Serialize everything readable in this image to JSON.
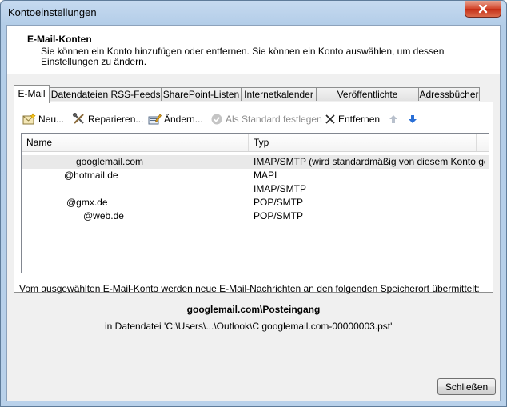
{
  "window": {
    "title": "Kontoeinstellungen"
  },
  "header": {
    "title": "E-Mail-Konten",
    "description": "Sie können ein Konto hinzufügen oder entfernen. Sie können ein Konto auswählen, um dessen Einstellungen zu ändern."
  },
  "tabs": [
    {
      "label": "E-Mail",
      "active": true
    },
    {
      "label": "Datendateien"
    },
    {
      "label": "RSS-Feeds"
    },
    {
      "label": "SharePoint-Listen"
    },
    {
      "label": "Internetkalender"
    },
    {
      "label": "Veröffentlichte Kalender"
    },
    {
      "label": "Adressbücher"
    }
  ],
  "toolbar": {
    "new_label": "Neu...",
    "repair_label": "Reparieren...",
    "change_label": "Ändern...",
    "default_label": "Als Standard festlegen",
    "remove_label": "Entfernen"
  },
  "accounts": {
    "columns": {
      "name": "Name",
      "type": "Typ"
    },
    "rows": [
      {
        "name": "googlemail.com",
        "type": "IMAP/SMTP (wird standardmäßig von diesem Konto ge...",
        "selected": true
      },
      {
        "name": "@hotmail.de",
        "type": "MAPI"
      },
      {
        "name": "",
        "type": "IMAP/SMTP"
      },
      {
        "name": "@gmx.de",
        "type": "POP/SMTP"
      },
      {
        "name": "@web.de",
        "type": "POP/SMTP"
      }
    ]
  },
  "delivery": {
    "info": "Vom ausgewählten E-Mail-Konto werden neue E-Mail-Nachrichten an den folgenden Speicherort übermittelt:",
    "folder": "googlemail.com\\Posteingang",
    "file": "in Datendatei 'C:\\Users\\...\\Outlook\\C                          googlemail.com-00000003.pst'"
  },
  "footer": {
    "close_label": "Schließen"
  },
  "colors": {
    "title_bar": "#b9d1ea",
    "close_red": "#c42e16",
    "arrow_blue": "#2a6fd6"
  }
}
